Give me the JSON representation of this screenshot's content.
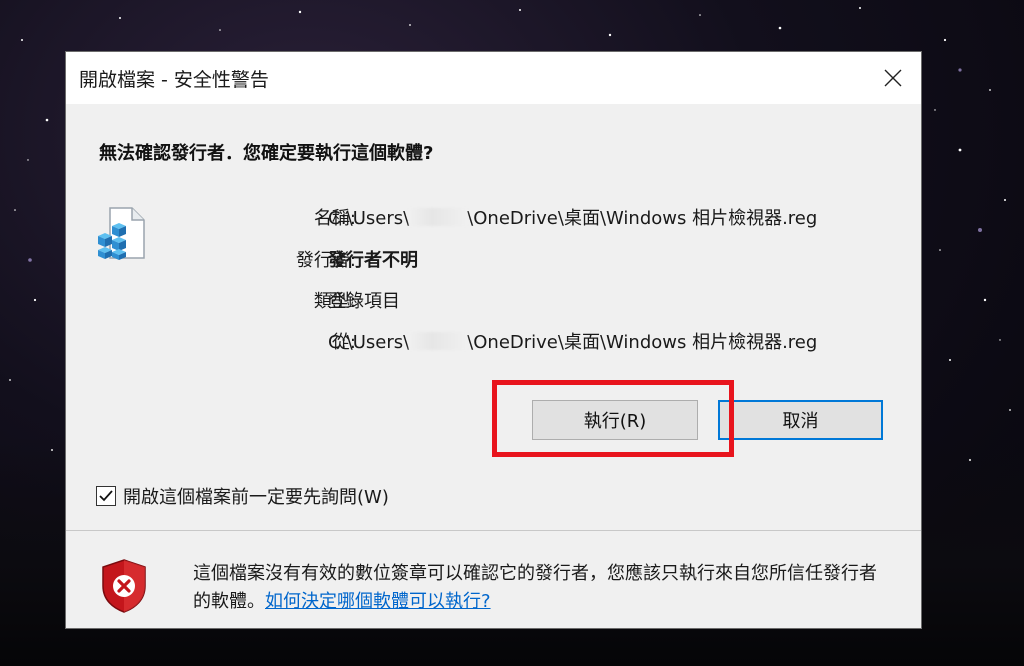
{
  "dialog": {
    "title": "開啟檔案 - 安全性警告",
    "heading": "無法確認發行者．您確定要執行這個軟體?",
    "fields": [
      {
        "label": "名稱:",
        "value_prefix": "C:\\Users\\",
        "value_suffix": "\\OneDrive\\桌面\\Windows 相片檢視器.reg",
        "bold": false
      },
      {
        "label": "發行者:",
        "value": "發行者不明",
        "bold": true
      },
      {
        "label": "類型:",
        "value": "登錄項目",
        "bold": false
      },
      {
        "label": "從:",
        "value_prefix": "C:\\Users\\",
        "value_suffix": "\\OneDrive\\桌面\\Windows 相片檢視器.reg",
        "bold": false
      }
    ],
    "buttons": {
      "run": "執行(R)",
      "cancel": "取消"
    },
    "checkbox": {
      "label": "開啟這個檔案前一定要先詢問(W)",
      "checked": true
    },
    "warning_text": "這個檔案沒有有效的數位簽章可以確認它的發行者，您應該只執行來自您所信任發行者的軟體。",
    "help_link": "如何決定哪個軟體可以執行?",
    "icons": {
      "close": "close-icon",
      "file": "registry-file-icon",
      "shield": "error-shield-icon"
    }
  },
  "colors": {
    "highlight": "#e8141d",
    "link": "#0066cc",
    "focus_border": "#0078d7"
  }
}
